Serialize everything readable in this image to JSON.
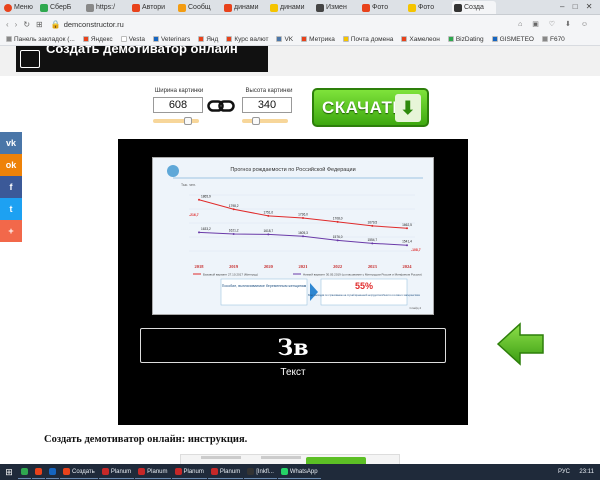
{
  "browser": {
    "menu_label": "Меню",
    "tabs": [
      {
        "label": "СберБ",
        "color": "#2fa84f"
      },
      {
        "label": "https:/",
        "color": "#888888"
      },
      {
        "label": "Автори",
        "color": "#e8421b"
      },
      {
        "label": "Сообщ",
        "color": "#f39c12"
      },
      {
        "label": "динами",
        "color": "#e8421b"
      },
      {
        "label": "динами",
        "color": "#f5c400"
      },
      {
        "label": "Измен",
        "color": "#444444"
      },
      {
        "label": "Фото",
        "color": "#e8421b"
      },
      {
        "label": "Фото",
        "color": "#f5c400"
      },
      {
        "label": "Созда",
        "color": "#333333",
        "active": true
      }
    ],
    "url": "demconstructor.ru",
    "bookmarks": [
      {
        "label": "Панель закладок (...",
        "color": "#888888"
      },
      {
        "label": "Яндекс",
        "color": "#e8421b"
      },
      {
        "label": "Vesta",
        "color": "#ffffff"
      },
      {
        "label": "Veterinars",
        "color": "#1565c0"
      },
      {
        "label": "Янд",
        "color": "#e8421b"
      },
      {
        "label": "Курс валют",
        "color": "#e8421b"
      },
      {
        "label": "VK",
        "color": "#4a76a8"
      },
      {
        "label": "Метрика",
        "color": "#e8421b"
      },
      {
        "label": "Почта домена",
        "color": "#f5c400"
      },
      {
        "label": "Хамелеон",
        "color": "#e8421b"
      },
      {
        "label": "BizDating",
        "color": "#2fa84f"
      },
      {
        "label": "GISMETEO",
        "color": "#1565c0"
      },
      {
        "label": "F670",
        "color": "#888888"
      }
    ]
  },
  "header": {
    "title": "Создать демотиватор онлайн"
  },
  "social": [
    {
      "icon": "vk-icon",
      "glyph": "vk",
      "color": "#4a76a8"
    },
    {
      "icon": "ok-icon",
      "glyph": "ok",
      "color": "#ee8208"
    },
    {
      "icon": "facebook-icon",
      "glyph": "f",
      "color": "#3b5998"
    },
    {
      "icon": "twitter-icon",
      "glyph": "t",
      "color": "#1da1f2"
    },
    {
      "icon": "plus-icon",
      "glyph": "+",
      "color": "#f2684a"
    }
  ],
  "controls": {
    "width_label": "Ширина картинки",
    "width_value": "608",
    "height_label": "Высота картинки",
    "height_value": "340",
    "width_slider_fraction": 0.75,
    "height_slider_fraction": 0.3,
    "download_label": "СКАЧАТЬ",
    "link_icon": "chain-link-icon"
  },
  "demotivator": {
    "main_text": "Зв",
    "sub_text": "Текст",
    "slide_title": "Прогноз рождаемости по Российской Федерации",
    "slide_unit": "Тыс. чел.",
    "slide_note_left": "Пособие, выплачиваемое беременным женщинам",
    "slide_percent": "55%",
    "slide_note_right": "Всех расходов по страхованию на случай временной нетрудоспособности и в связи с материнством",
    "slide_footer": "Слайд 4",
    "legend": [
      "Базовый вариант 27.10.2017 (Минтруд)",
      "Низкий вариант 30.05.2019 (согласование с Минтрудом Россия и Минфином России)"
    ]
  },
  "chart_data": {
    "type": "line",
    "categories": [
      "2018",
      "2019",
      "2020",
      "2021",
      "2022",
      "2023",
      "2024"
    ],
    "series": [
      {
        "name": "Базовый вариант",
        "color": "#e02a2a",
        "values": [
          1865.9,
          1798.2,
          1751.0,
          1736.0,
          1708.0,
          1679.5,
          1662.5
        ]
      },
      {
        "name": "Низкий вариант",
        "color": "#6a3aa8",
        "values": [
          1633.2,
          1621.2,
          1618.7,
          1605.3,
          1576.0,
          1554.7,
          1541.4
        ]
      }
    ],
    "annotations": [
      "-216,7",
      "-108,7"
    ],
    "ylim": [
      1450,
      1950
    ]
  },
  "instruction": {
    "title": "Создать демотиватор онлайн: инструкция."
  },
  "taskbar": {
    "items": [
      {
        "label": "",
        "color": "#2fa84f"
      },
      {
        "label": "",
        "color": "#e8421b"
      },
      {
        "label": "",
        "color": "#1565c0"
      },
      {
        "label": "Создать",
        "color": "#e8421b"
      },
      {
        "label": "Planum",
        "color": "#c62828"
      },
      {
        "label": "Planum",
        "color": "#c62828"
      },
      {
        "label": "Planum",
        "color": "#c62828"
      },
      {
        "label": "Planum",
        "color": "#c62828"
      },
      {
        "label": "[Inkfl...",
        "color": "#333333"
      },
      {
        "label": "WhatsApp",
        "color": "#25d366"
      }
    ],
    "lang": "РУС",
    "time": "23:11"
  }
}
